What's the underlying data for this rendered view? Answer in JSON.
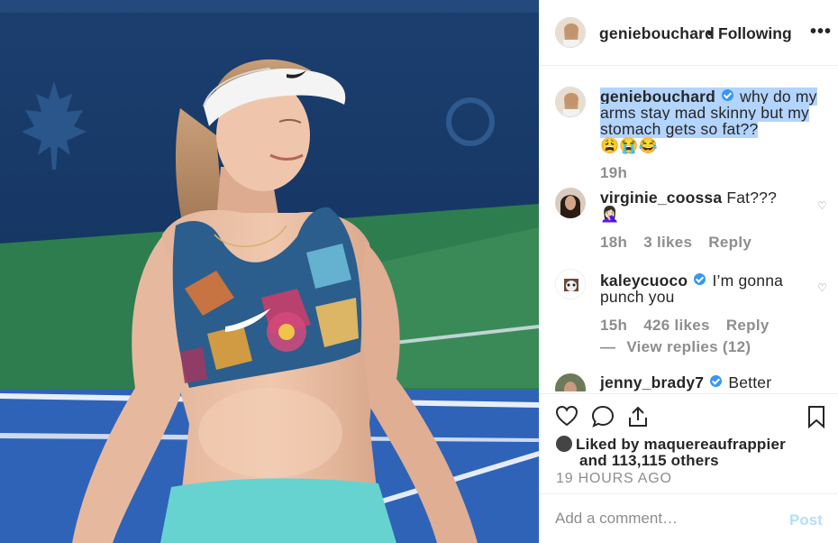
{
  "post": {
    "author": "geniebouchard",
    "separator": "•",
    "follow_status": "Following",
    "more_label": "•••"
  },
  "caption": {
    "username": "geniebouchard",
    "text": "why do my arms stay mad skinny but my stomach gets so fat??",
    "emojis": "😩😭😂",
    "time": "19h"
  },
  "comments": [
    {
      "username": "virginie_coossa",
      "text": "Fat???",
      "emoji": "🤦🏻‍♀️",
      "time": "18h",
      "likes": "3 likes",
      "reply": "Reply"
    },
    {
      "username": "kaleycuoco",
      "text": "I’m gonna punch you",
      "time": "15h",
      "likes": "426 likes",
      "reply": "Reply",
      "view_replies": "View replies (12)"
    },
    {
      "username": "jenny_brady7",
      "text": "Better"
    }
  ],
  "engagement": {
    "liked_by_prefix": "Liked by",
    "liked_by_user": "maquereaufrappier",
    "liked_by_suffix": "and",
    "others": "113,115 others",
    "timestamp": "19 HOURS AGO"
  },
  "add_comment": {
    "placeholder": "Add a comment…",
    "post_label": "Post"
  },
  "colors": {
    "court_blue": "#1d4a8a",
    "court_green": "#2e7d4f",
    "verified": "#3897f0",
    "selection": "#b3d4fc",
    "post_disabled": "#b2dffc"
  },
  "icons": [
    "heart-icon",
    "comment-icon",
    "share-icon",
    "bookmark-icon",
    "more-icon",
    "verified-icon"
  ]
}
